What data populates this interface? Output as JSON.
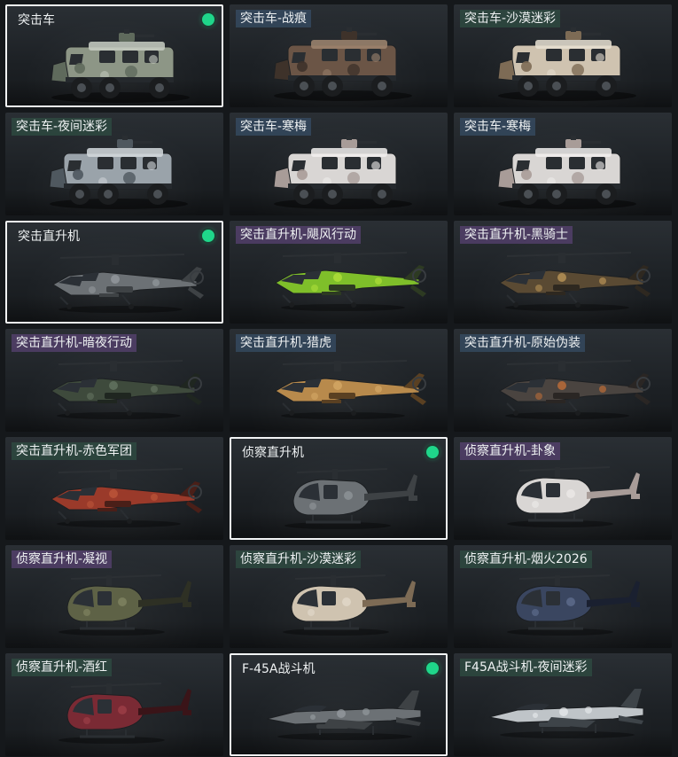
{
  "cards": [
    {
      "label": "突击车",
      "type": "truck",
      "camo": "green",
      "selected": true,
      "equipped": true,
      "tag": "plain"
    },
    {
      "label": "突击车-战痕",
      "type": "truck",
      "camo": "rust",
      "selected": false,
      "equipped": false,
      "tag": "blue"
    },
    {
      "label": "突击车-沙漠迷彩",
      "type": "truck",
      "camo": "desert",
      "selected": false,
      "equipped": false,
      "tag": "green"
    },
    {
      "label": "突击车-夜间迷彩",
      "type": "truck",
      "camo": "night",
      "selected": false,
      "equipped": false,
      "tag": "green"
    },
    {
      "label": "突击车-寒梅",
      "type": "truck",
      "camo": "white",
      "selected": false,
      "equipped": false,
      "tag": "blue"
    },
    {
      "label": "突击车-寒梅",
      "type": "truck",
      "camo": "white",
      "selected": false,
      "equipped": false,
      "tag": "blue"
    },
    {
      "label": "突击直升机",
      "type": "apache",
      "camo": "grey",
      "selected": true,
      "equipped": true,
      "tag": "plain"
    },
    {
      "label": "突击直升机-飓风行动",
      "type": "apache",
      "camo": "neon",
      "selected": false,
      "equipped": false,
      "tag": "purple"
    },
    {
      "label": "突击直升机-黑骑士",
      "type": "apache",
      "camo": "gold",
      "selected": false,
      "equipped": false,
      "tag": "purple"
    },
    {
      "label": "突击直升机-暗夜行动",
      "type": "apache",
      "camo": "darkgreen",
      "selected": false,
      "equipped": false,
      "tag": "purple"
    },
    {
      "label": "突击直升机-猎虎",
      "type": "apache",
      "camo": "tiger",
      "selected": false,
      "equipped": false,
      "tag": "blue"
    },
    {
      "label": "突击直升机-原始伪装",
      "type": "apache",
      "camo": "orange",
      "selected": false,
      "equipped": false,
      "tag": "blue"
    },
    {
      "label": "突击直升机-赤色军团",
      "type": "apache",
      "camo": "red",
      "selected": false,
      "equipped": false,
      "tag": "green"
    },
    {
      "label": "侦察直升机",
      "type": "scout",
      "camo": "grey",
      "selected": true,
      "equipped": true,
      "tag": "plain"
    },
    {
      "label": "侦察直升机-卦象",
      "type": "scout",
      "camo": "white",
      "selected": false,
      "equipped": false,
      "tag": "purple"
    },
    {
      "label": "侦察直升机-凝视",
      "type": "scout",
      "camo": "olive",
      "selected": false,
      "equipped": false,
      "tag": "purple"
    },
    {
      "label": "侦察直升机-沙漠迷彩",
      "type": "scout",
      "camo": "desert",
      "selected": false,
      "equipped": false,
      "tag": "green"
    },
    {
      "label": "侦察直升机-烟火2026",
      "type": "scout",
      "camo": "navy",
      "selected": false,
      "equipped": false,
      "tag": "green"
    },
    {
      "label": "侦察直升机-酒红",
      "type": "scout",
      "camo": "wine",
      "selected": false,
      "equipped": false,
      "tag": "green"
    },
    {
      "label": "F-45A战斗机",
      "type": "jet",
      "camo": "grey",
      "selected": true,
      "equipped": true,
      "tag": "plain"
    },
    {
      "label": "F45A战斗机-夜间迷彩",
      "type": "jet",
      "camo": "snow",
      "selected": false,
      "equipped": false,
      "tag": "green"
    }
  ],
  "palettes": {
    "green": [
      "#8d9686",
      "#5f6a5c",
      "#c9cfc4"
    ],
    "rust": [
      "#6b5546",
      "#3e322a",
      "#a08670"
    ],
    "desert": [
      "#cfc3b0",
      "#7d6b55",
      "#e8e0d2"
    ],
    "night": [
      "#9aa3aa",
      "#4f585f",
      "#d5dade"
    ],
    "white": [
      "#d9d6d4",
      "#a89c98",
      "#f1efed"
    ],
    "grey": [
      "#6c7175",
      "#3e4245",
      "#9aa0a4"
    ],
    "neon": [
      "#7fbf2a",
      "#2d3a22",
      "#b6e53c"
    ],
    "gold": [
      "#5a4a33",
      "#2e2820",
      "#c79f5c"
    ],
    "darkgreen": [
      "#3e4a3c",
      "#1f2620",
      "#6a7a66"
    ],
    "tiger": [
      "#b88a4c",
      "#5a4022",
      "#d9ad6a"
    ],
    "orange": [
      "#4a4440",
      "#2a2624",
      "#d07336"
    ],
    "red": [
      "#9a3a2a",
      "#4a1f18",
      "#c25a3c"
    ],
    "olive": [
      "#5e6246",
      "#2e3024",
      "#8c8f6a"
    ],
    "navy": [
      "#3a4660",
      "#1a2030",
      "#6a7a9c"
    ],
    "wine": [
      "#7a2a34",
      "#3a1418",
      "#a8464e"
    ],
    "snow": [
      "#bfc4c8",
      "#3e4449",
      "#e9ecee"
    ]
  },
  "colors": {
    "selected_border": "#f2f4f5",
    "equipped_badge": "#1fd68a"
  }
}
